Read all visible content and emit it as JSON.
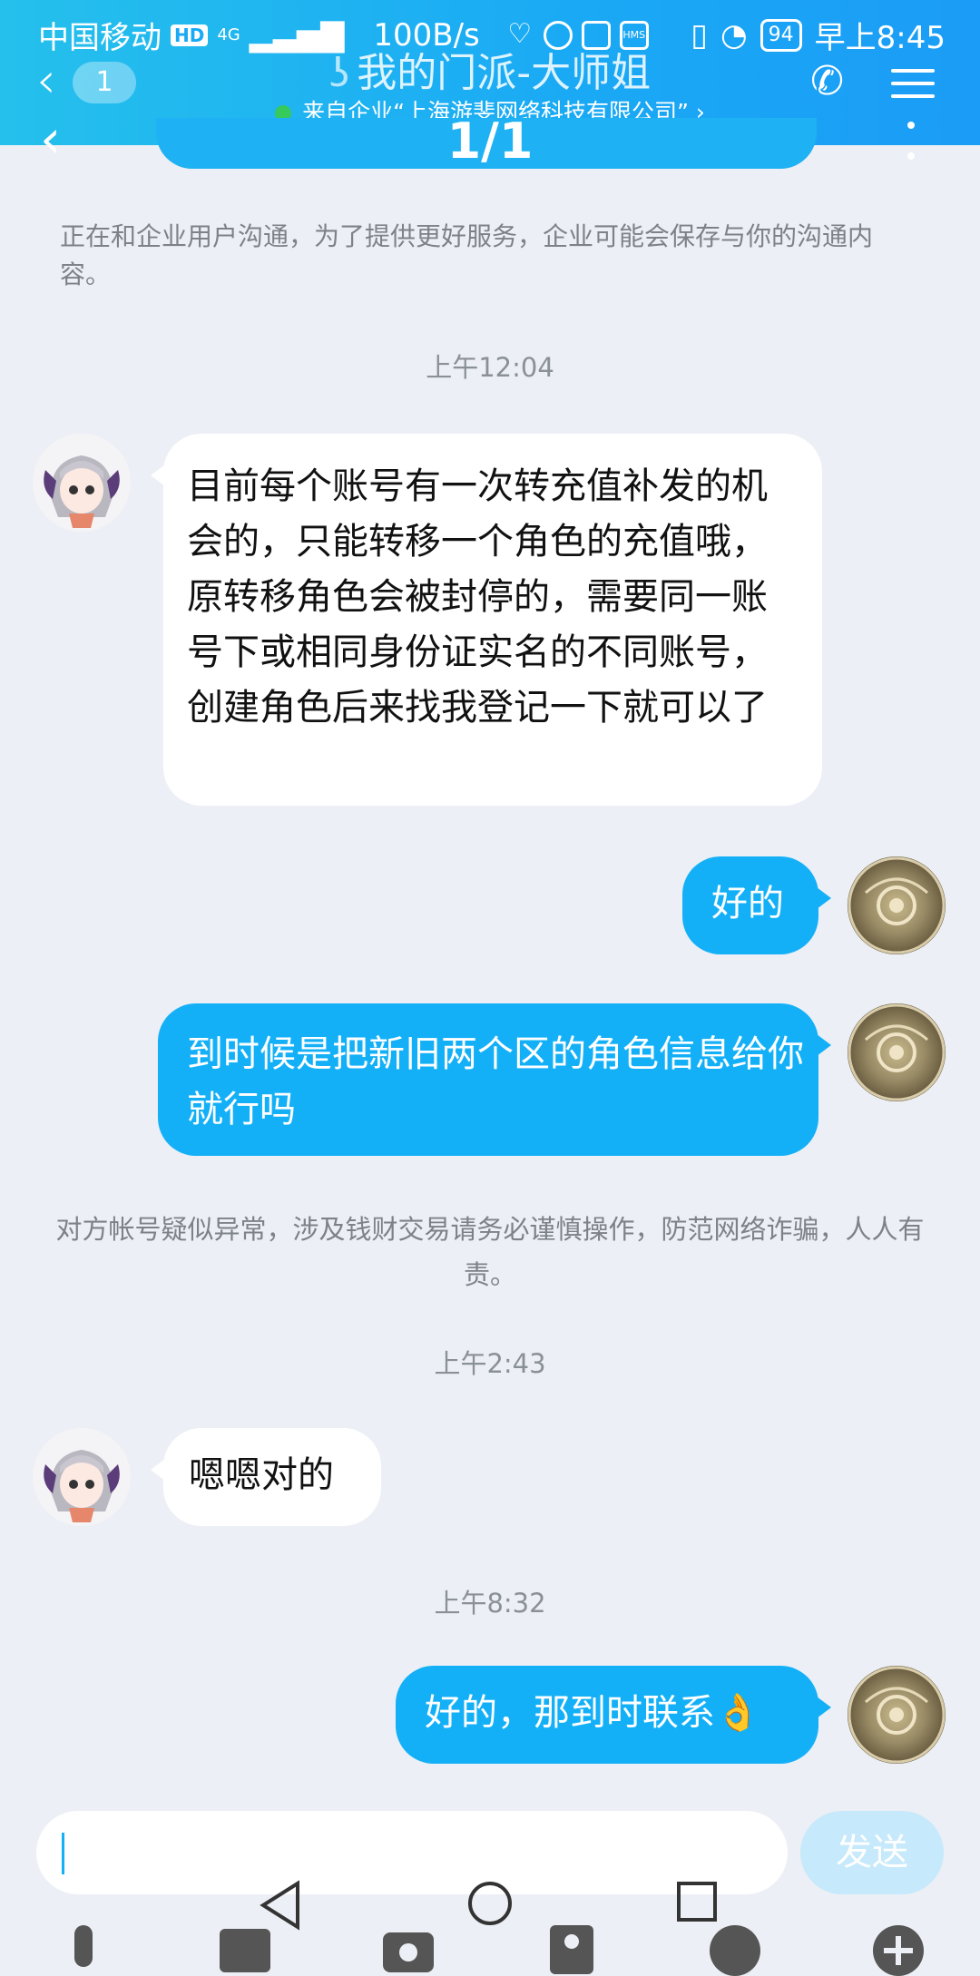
{
  "status_bar": {
    "carrier": "中国移动",
    "hd": "HD",
    "network": "4G",
    "speed": "100B/s",
    "hms": "HMS",
    "battery": "94",
    "time": "早上8:45"
  },
  "header": {
    "unread_count": "1",
    "title": "我的门派-大师姐",
    "subtitle": "来自企业“上海游斐网络科技有限公司”",
    "subtitle_chevron": "›"
  },
  "overlay": {
    "counter": "1/1"
  },
  "chat": {
    "notice_top": "正在和企业用户沟通，为了提供更好服务，企业可能会保存与你的沟通内容。",
    "timestamp_1": "上午12:04",
    "msg_1": "目前每个账号有一次转充值补发的机会的，只能转移一个角色的充值哦，原转移角色会被封停的，需要同一账号下或相同身份证实名的不同账号，创建角色后来找我登记一下就可以了",
    "msg_2": "好的",
    "msg_3": "到时候是把新旧两个区的角色信息给你就行吗",
    "warning": "对方帐号疑似异常，涉及钱财交易请务必谨慎操作，防范网络诈骗，人人有责。",
    "timestamp_2": "上午2:43",
    "msg_4": "嗯嗯对的",
    "timestamp_3": "上午8:32",
    "msg_5": "好的，那到时联系👌"
  },
  "input": {
    "send_label": "发送"
  },
  "colors": {
    "accent": "#14b0f7",
    "header": "#1aa9f5",
    "background": "#eceff5"
  }
}
